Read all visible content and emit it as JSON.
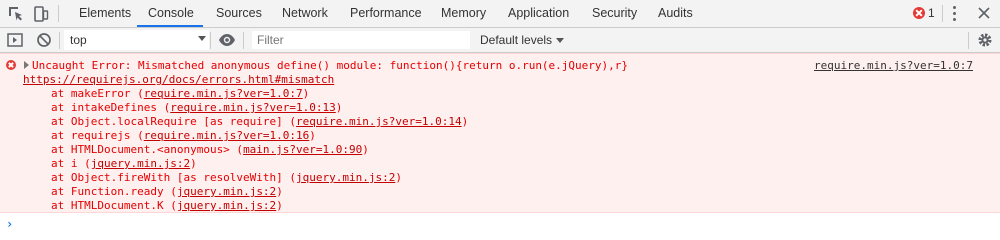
{
  "tabs": [
    {
      "label": "Elements"
    },
    {
      "label": "Console"
    },
    {
      "label": "Sources"
    },
    {
      "label": "Network"
    },
    {
      "label": "Performance"
    },
    {
      "label": "Memory"
    },
    {
      "label": "Application"
    },
    {
      "label": "Security"
    },
    {
      "label": "Audits"
    }
  ],
  "selected_tab": "Console",
  "error_count": "1",
  "toolbar": {
    "context": "top",
    "filter_placeholder": "Filter",
    "levels": "Default levels"
  },
  "error": {
    "message": "Uncaught Error: Mismatched anonymous define() module: function(){return o.run(e.jQuery),r}",
    "doc_link": "https://requirejs.org/docs/errors.html#mismatch",
    "source": "require.min.js?ver=1.0:7",
    "stack": [
      {
        "prefix": "at makeError (",
        "link": "require.min.js?ver=1.0:7",
        "suffix": ")"
      },
      {
        "prefix": "at intakeDefines (",
        "link": "require.min.js?ver=1.0:13",
        "suffix": ")"
      },
      {
        "prefix": "at Object.localRequire [as require] (",
        "link": "require.min.js?ver=1.0:14",
        "suffix": ")"
      },
      {
        "prefix": "at requirejs (",
        "link": "require.min.js?ver=1.0:16",
        "suffix": ")"
      },
      {
        "prefix": "at HTMLDocument.<anonymous> (",
        "link": "main.js?ver=1.0:90",
        "suffix": ")"
      },
      {
        "prefix": "at i (",
        "link": "jquery.min.js:2",
        "suffix": ")"
      },
      {
        "prefix": "at Object.fireWith [as resolveWith] (",
        "link": "jquery.min.js:2",
        "suffix": ")"
      },
      {
        "prefix": "at Function.ready (",
        "link": "jquery.min.js:2",
        "suffix": ")"
      },
      {
        "prefix": "at HTMLDocument.K (",
        "link": "jquery.min.js:2",
        "suffix": ")"
      }
    ]
  },
  "prompt_symbol": "›",
  "colors": {
    "accent": "#1a73e8",
    "error_text": "#e50000",
    "error_bg": "#fff0f0",
    "error_icon": "#e53935"
  }
}
